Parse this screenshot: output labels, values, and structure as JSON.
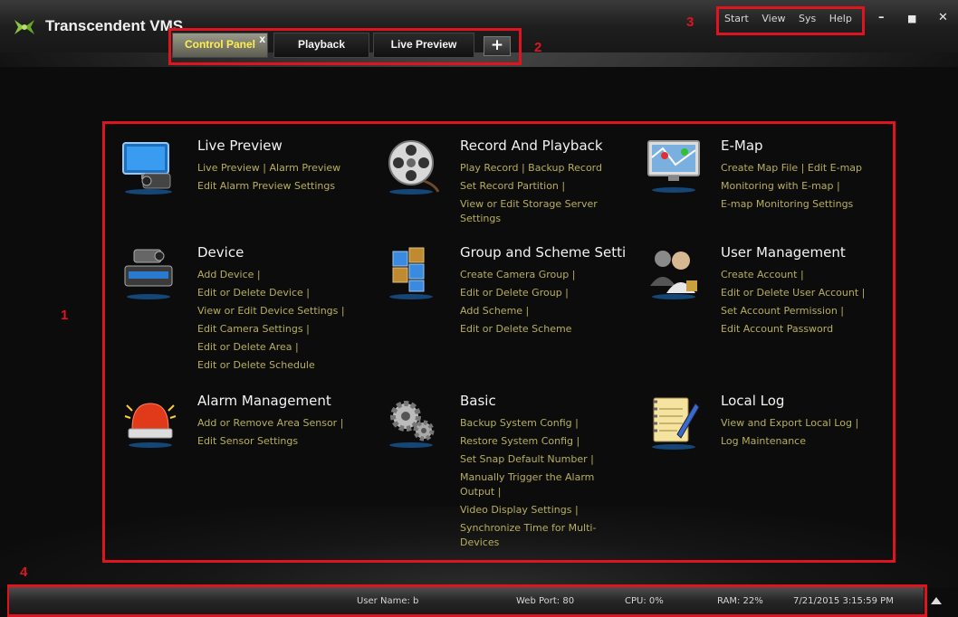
{
  "app": {
    "title": "Transcendent VMS"
  },
  "tabs": [
    {
      "label": "Control Panel",
      "close": "x"
    },
    {
      "label": "Playback"
    },
    {
      "label": "Live Preview"
    },
    {
      "label": "+"
    }
  ],
  "menu": [
    "Start",
    "View",
    "Sys",
    "Help"
  ],
  "window_controls": {
    "minimize": "–",
    "maximize": "■",
    "close": "✕"
  },
  "annotations": [
    "1",
    "2",
    "3",
    "4"
  ],
  "sections": [
    {
      "title": "Live Preview",
      "icon": "monitor-camera-icon",
      "links": [
        [
          "Live Preview | ",
          "Alarm Preview"
        ],
        [
          "Edit Alarm Preview Settings"
        ]
      ]
    },
    {
      "title": "Record And Playback",
      "icon": "film-reel-icon",
      "links": [
        [
          "Play Record | ",
          "Backup Record"
        ],
        [
          "Set Record Partition |"
        ],
        [
          "View or Edit Storage Server Settings"
        ]
      ]
    },
    {
      "title": "E-Map",
      "icon": "map-monitor-icon",
      "links": [
        [
          "Create Map File | ",
          "Edit E-map"
        ],
        [
          "Monitoring with E-map |"
        ],
        [
          "E-map Monitoring Settings"
        ]
      ]
    },
    {
      "title": "Device",
      "icon": "camera-dvr-icon",
      "links": [
        [
          "Add Device |"
        ],
        [
          "Edit or Delete Device |"
        ],
        [
          "View or Edit Device Settings |"
        ],
        [
          "Edit Camera Settings |"
        ],
        [
          "Edit or Delete Area |"
        ],
        [
          "Edit or Delete Schedule"
        ]
      ]
    },
    {
      "title": "Group and Scheme Setti",
      "icon": "cube-group-icon",
      "links": [
        [
          "Create Camera Group |"
        ],
        [
          "Edit or Delete Group |"
        ],
        [
          "Add Scheme |"
        ],
        [
          "Edit or Delete Scheme"
        ]
      ]
    },
    {
      "title": "User Management",
      "icon": "users-icon",
      "links": [
        [
          "Create Account |"
        ],
        [
          "Edit or Delete User Account |"
        ],
        [
          "Set Account Permission |"
        ],
        [
          "Edit Account Password"
        ]
      ]
    },
    {
      "title": "Alarm Management",
      "icon": "alarm-siren-icon",
      "links": [
        [
          "Add or Remove Area Sensor |"
        ],
        [
          "Edit Sensor Settings"
        ]
      ]
    },
    {
      "title": "Basic",
      "icon": "gears-icon",
      "links": [
        [
          "Backup System Config |"
        ],
        [
          "Restore System Config |"
        ],
        [
          "Set Snap Default Number |"
        ],
        [
          "Manually Trigger the Alarm Output |"
        ],
        [
          "Video Display Settings |"
        ],
        [
          "Synchronize Time for Multi-Devices"
        ]
      ]
    },
    {
      "title": "Local Log",
      "icon": "notepad-icon",
      "links": [
        [
          "View and Export Local Log |"
        ],
        [
          "Log Maintenance"
        ]
      ]
    }
  ],
  "status": {
    "user": "User Name: b",
    "port": "Web Port: 80",
    "cpu": "CPU: 0%",
    "ram": "RAM: 22%",
    "datetime": "7/21/2015 3:15:59 PM"
  },
  "colors": {
    "accent_tab": "#ffef4d",
    "link": "#b8ae5a",
    "annotation": "#e0141e"
  }
}
